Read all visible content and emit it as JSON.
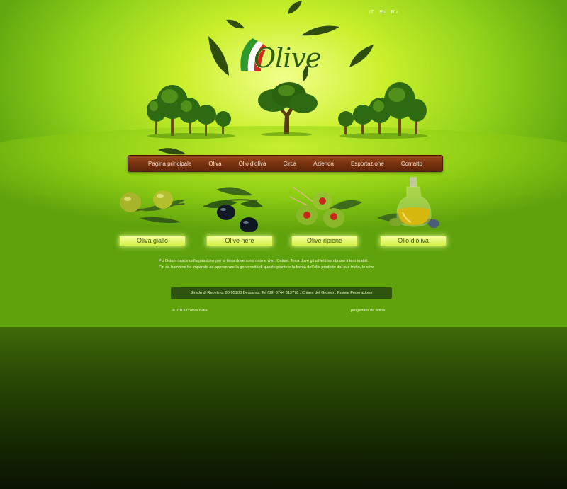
{
  "header": {
    "languages": [
      "IT",
      "En",
      "Ru"
    ],
    "logo_text": "Olive"
  },
  "nav": {
    "items": [
      "Pagina principale",
      "Oliva",
      "Olio d'oliva",
      "Circa",
      "Azienda",
      "Esportazione",
      "Contatto"
    ]
  },
  "products": [
    {
      "label": "Oliva giallo"
    },
    {
      "label": "Olive nere"
    },
    {
      "label": "Olive ripiene"
    },
    {
      "label": "Olio d'oliva"
    }
  ],
  "about": {
    "line1": "PurOstuni nasce dalla passione per la terra dove sono nato e vivo: Ostuni. Terra dove gli ulivetti sembrano interminabili.",
    "line2": "Fin da bambino ho imparato ad apprezzare la generosità di queste piante e la bontà dell'olio prodotto dal suo frutto, le olive"
  },
  "footer": {
    "address": "Strada di Recetino, 80-95100 Bergamo, Tel (39) 0744 813778 , Chiara del Grosso : Russia Federazione",
    "copyright": "© 2013   D'oliva Italia",
    "credit": "progettato da retina"
  },
  "colors": {
    "accent_green": "#2e5f0c",
    "nav_wood": "#7a3410",
    "button_glow": "#f4ff9e",
    "flag_green": "#2f9a2c",
    "flag_white": "#ffffff",
    "flag_red": "#d9261c"
  }
}
